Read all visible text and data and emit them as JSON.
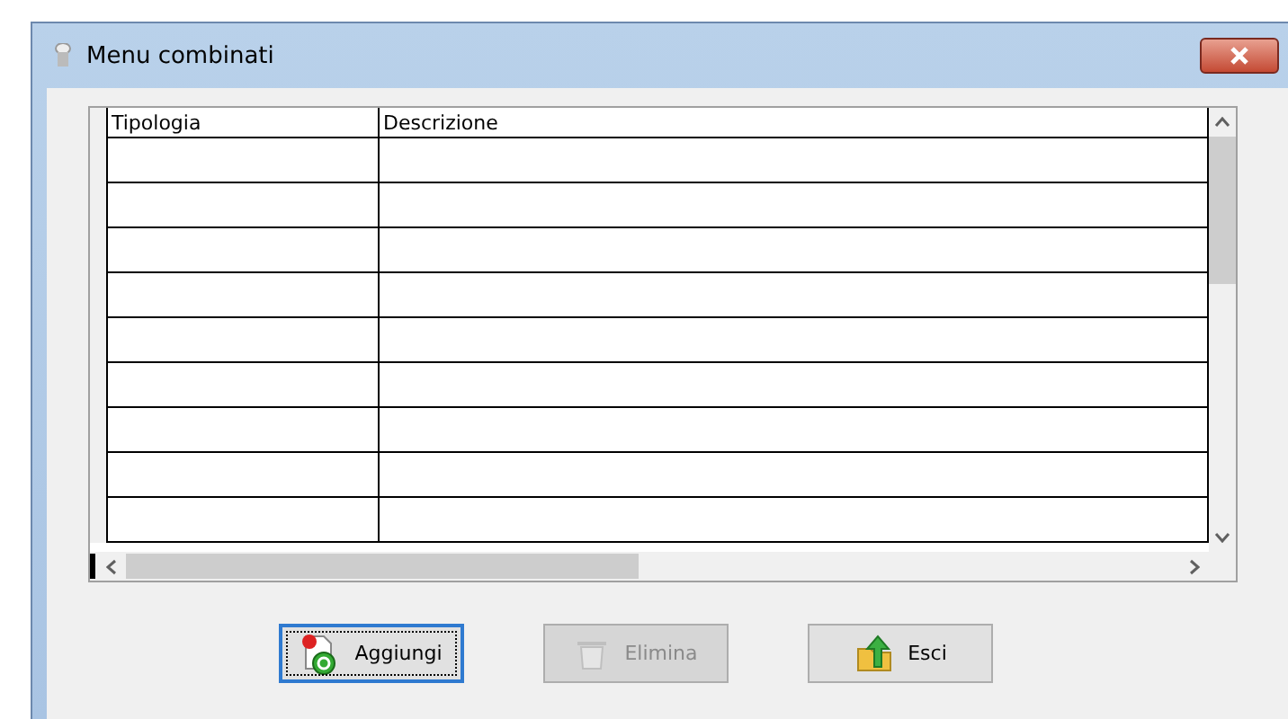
{
  "window": {
    "title": "Menu combinati"
  },
  "table": {
    "columns": [
      "Tipologia",
      "Descrizione"
    ]
  },
  "buttons": [
    {
      "label": "Aggiungi",
      "kind": "add",
      "disabled": false,
      "focused": true
    },
    {
      "label": "Elimina",
      "kind": "delete",
      "disabled": true,
      "focused": false
    },
    {
      "label": "Esci",
      "kind": "exit",
      "disabled": false,
      "focused": false
    }
  ]
}
